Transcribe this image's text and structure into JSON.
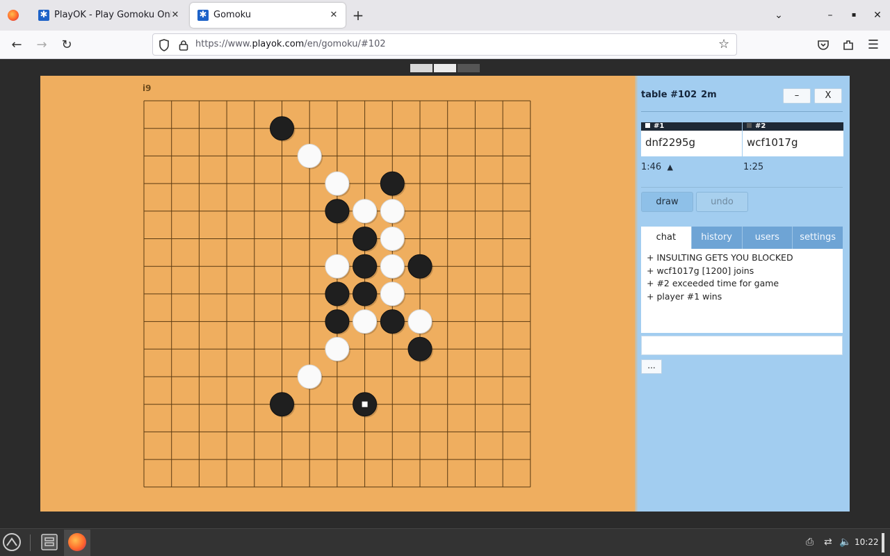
{
  "browser": {
    "tabs": [
      {
        "label": "PlayOK - Play Gomoku Online",
        "active": false
      },
      {
        "label": "Gomoku",
        "active": true
      }
    ],
    "close_glyph": "✕",
    "new_tab_glyph": "+",
    "window_controls": {
      "collapse": "⌄",
      "minimize": "–",
      "maximize": "▪",
      "close": "✕"
    },
    "url": {
      "prefix": "https://www.",
      "domain": "playok.com",
      "path": "/en/gomoku/#102"
    }
  },
  "game": {
    "coordinate_label": "i9",
    "board_size": 15,
    "stones": [
      {
        "col": 5,
        "row": 1,
        "color": "black"
      },
      {
        "col": 6,
        "row": 2,
        "color": "white"
      },
      {
        "col": 7,
        "row": 3,
        "color": "white"
      },
      {
        "col": 9,
        "row": 3,
        "color": "black"
      },
      {
        "col": 7,
        "row": 4,
        "color": "black"
      },
      {
        "col": 8,
        "row": 4,
        "color": "white"
      },
      {
        "col": 9,
        "row": 4,
        "color": "white"
      },
      {
        "col": 8,
        "row": 5,
        "color": "black"
      },
      {
        "col": 9,
        "row": 5,
        "color": "white"
      },
      {
        "col": 7,
        "row": 6,
        "color": "white"
      },
      {
        "col": 8,
        "row": 6,
        "color": "black"
      },
      {
        "col": 9,
        "row": 6,
        "color": "white"
      },
      {
        "col": 10,
        "row": 6,
        "color": "black"
      },
      {
        "col": 7,
        "row": 7,
        "color": "black"
      },
      {
        "col": 8,
        "row": 7,
        "color": "black"
      },
      {
        "col": 9,
        "row": 7,
        "color": "white"
      },
      {
        "col": 7,
        "row": 8,
        "color": "black"
      },
      {
        "col": 8,
        "row": 8,
        "color": "white"
      },
      {
        "col": 9,
        "row": 8,
        "color": "black"
      },
      {
        "col": 10,
        "row": 8,
        "color": "white"
      },
      {
        "col": 7,
        "row": 9,
        "color": "white"
      },
      {
        "col": 10,
        "row": 9,
        "color": "black"
      },
      {
        "col": 6,
        "row": 10,
        "color": "white"
      },
      {
        "col": 5,
        "row": 11,
        "color": "black"
      },
      {
        "col": 8,
        "row": 11,
        "color": "black",
        "last_move": true
      }
    ]
  },
  "panel": {
    "table_title": "table #102",
    "table_time": "2m",
    "minimize_label": "–",
    "close_label": "X",
    "players": [
      {
        "seat": "#1",
        "name": "dnf2295g",
        "time": "1:46",
        "turn_marker": "▲",
        "seat_color": "#ffffff"
      },
      {
        "seat": "#2",
        "name": "wcf1017g",
        "time": "1:25",
        "turn_marker": "",
        "seat_color": "#555555"
      }
    ],
    "buttons": {
      "draw": "draw",
      "undo": "undo"
    },
    "tabs": [
      "chat",
      "history",
      "users",
      "settings"
    ],
    "chat_lines": [
      "+ INSULTING GETS YOU BLOCKED",
      "+ wcf1017g [1200] joins",
      "+ #2 exceeded time for game",
      "+ player #1 wins"
    ],
    "more_label": "..."
  },
  "taskbar": {
    "clock": "10:22"
  },
  "colors": {
    "board": "#efae5f",
    "panel": "#a2cdf0",
    "grid": "#5a3a12"
  }
}
